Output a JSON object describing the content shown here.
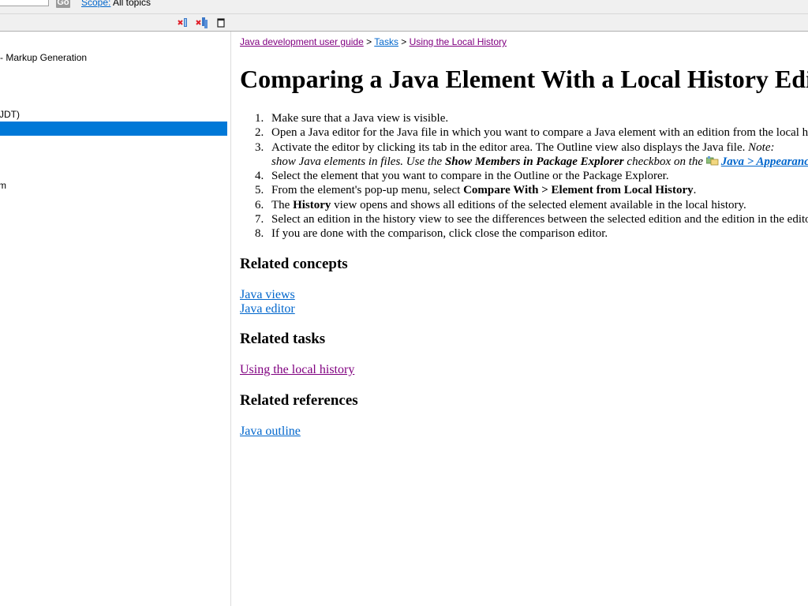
{
  "search": {
    "go_label": "Go",
    "scope_label": "Scope:",
    "scope_value": "All topics"
  },
  "toolbar": {
    "icons": [
      "remove-bookmark-icon",
      "remove-all-icon",
      "maximize-icon"
    ]
  },
  "tree": {
    "items": [
      " - Markup Generation",
      "JDT)",
      "m"
    ],
    "selected_index": 2
  },
  "breadcrumb": {
    "items": [
      "Java development user guide",
      "Tasks",
      "Using the Local History"
    ],
    "separator": ">"
  },
  "page": {
    "title": "Comparing a Java Element With a Local History Edition",
    "steps": [
      {
        "num": "1.",
        "text": "Make sure that a Java view is visible."
      },
      {
        "num": "2.",
        "text": "Open a Java editor for the Java file in which you want to compare a Java element with an edition from the local history."
      },
      {
        "num": "3.",
        "text": "Activate the editor by clicking its tab in the editor area. The Outline view also displays the Java file.",
        "note_label": "Note:"
      },
      {
        "num": "",
        "text_a": "show Java elements in files. Use the ",
        "bold": "Show Members in Package Explorer",
        "text_b": " checkbox on the ",
        "link": "Java > Appearance"
      },
      {
        "num": "4.",
        "text": "Select the element that you want to compare in the Outline or the Package Explorer."
      },
      {
        "num": "5.",
        "text_a": "From the element's pop-up menu, select ",
        "bold": "Compare With > Element from Local History",
        "text_b": "."
      },
      {
        "num": "6.",
        "text_a": "The ",
        "bold": "History",
        "text_b": " view opens and shows all editions of the selected element available in the local history."
      },
      {
        "num": "7.",
        "text": "Select an edition in the history view to see the differences between the selected edition and the edition in the editor."
      },
      {
        "num": "8.",
        "text": "If you are done with the comparison, click close the comparison editor."
      }
    ],
    "related_concepts": {
      "heading": "Related concepts",
      "links": [
        "Java views",
        "Java editor"
      ]
    },
    "related_tasks": {
      "heading": "Related tasks",
      "links": [
        "Using the local history"
      ]
    },
    "related_references": {
      "heading": "Related references",
      "links": [
        "Java outline"
      ]
    }
  },
  "colors": {
    "link": "#0066cc",
    "visited": "#800080",
    "selection": "#0078d7",
    "chrome": "#f0f0f0"
  }
}
